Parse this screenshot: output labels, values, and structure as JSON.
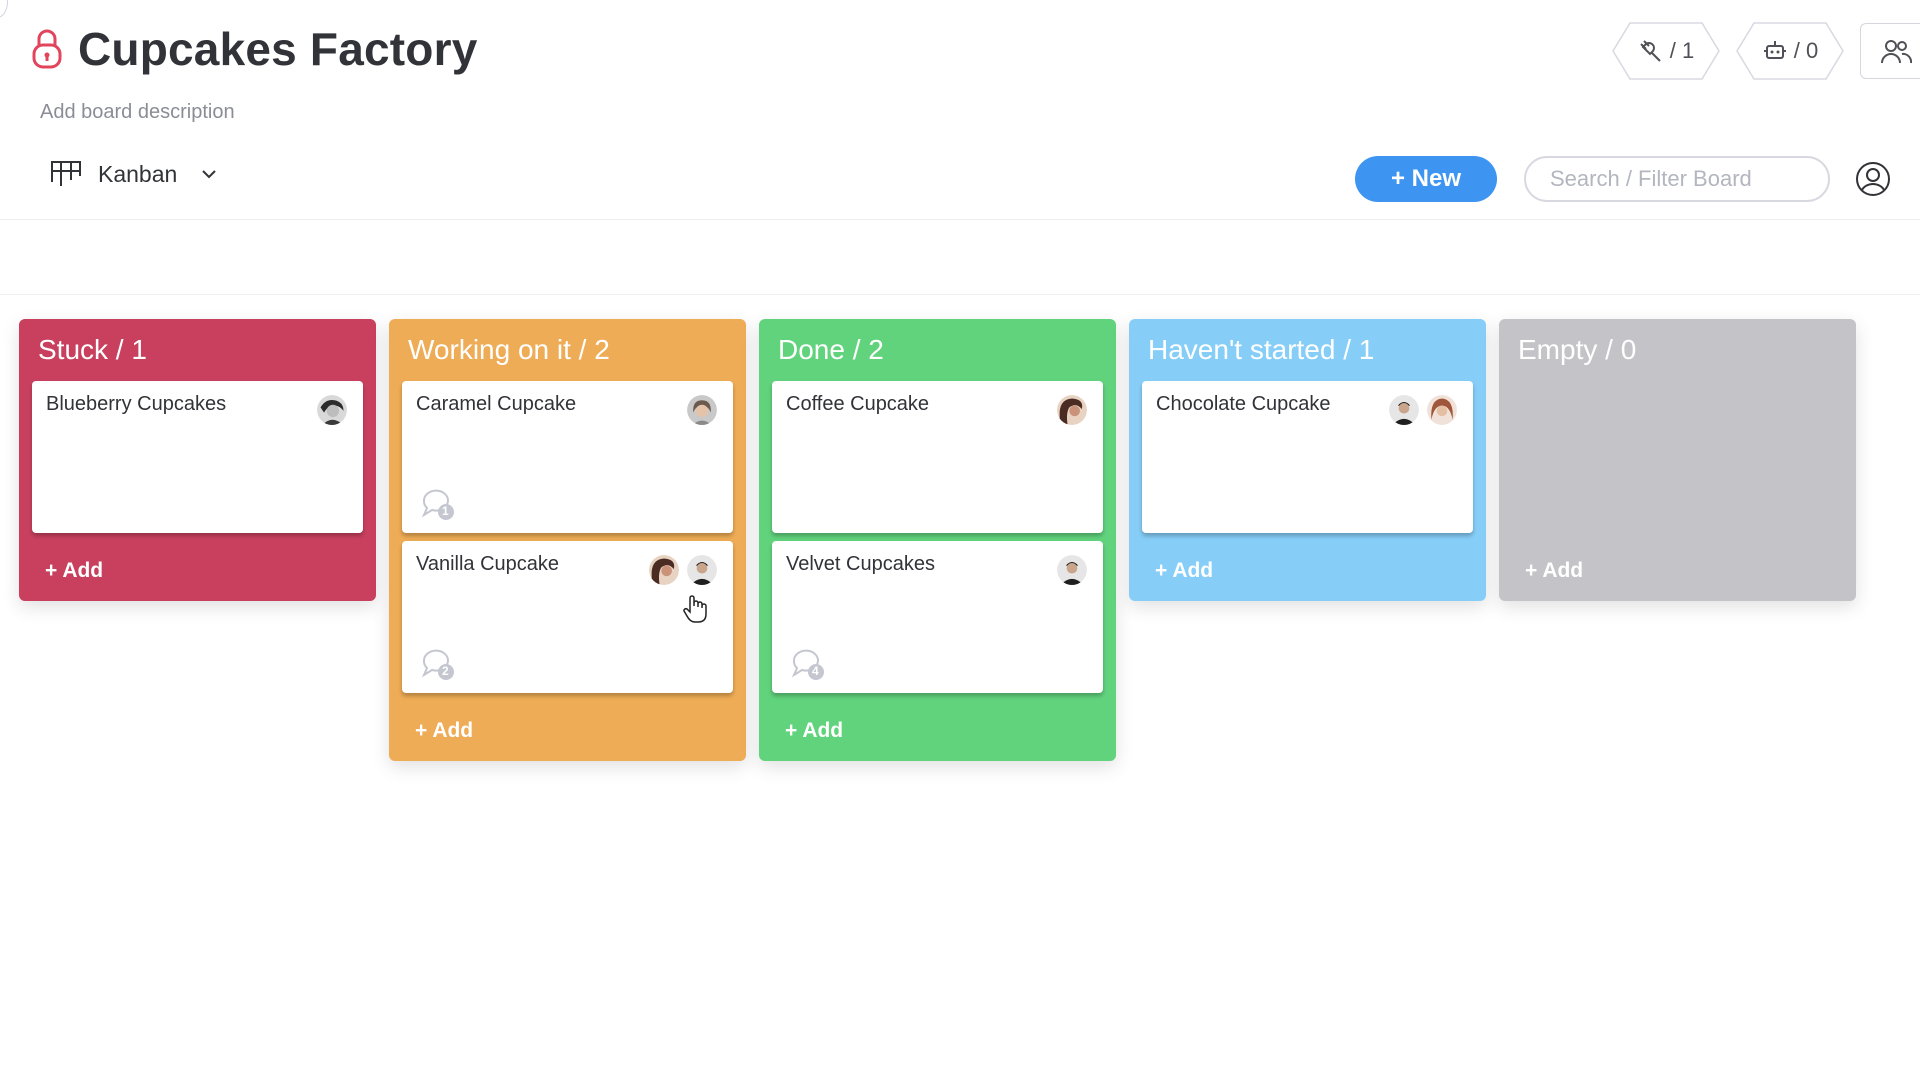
{
  "board": {
    "title": "Cupcakes Factory",
    "description": "Add board description",
    "lock_color": "#e2445c"
  },
  "header_actions": {
    "integrations_count": "/ 1",
    "automations_count": "/ 0",
    "integrations_icon": "plug-icon",
    "automations_icon": "robot-icon",
    "members_icon": "people-icon"
  },
  "toolbar": {
    "view_label": "Kanban",
    "new_label": "+ New",
    "search_placeholder": "Search / Filter Board",
    "accent": "#3d95f1"
  },
  "columns": [
    {
      "title": "Stuck / 1",
      "color": "#c9405f",
      "cards": [
        {
          "name": "Blueberry Cupcakes",
          "avatars": [
            "avatar-woman-bw"
          ],
          "comments": null
        }
      ],
      "add_label": "+ Add"
    },
    {
      "title": "Working on it / 2",
      "color": "#eeac56",
      "cards": [
        {
          "name": "Caramel Cupcake",
          "avatars": [
            "avatar-woman-gray"
          ],
          "comments": "1"
        },
        {
          "name": "Vanilla Cupcake",
          "avatars": [
            "avatar-woman-dark-hair",
            "avatar-man-dark"
          ],
          "comments": "2"
        }
      ],
      "add_label": "+ Add"
    },
    {
      "title": "Done / 2",
      "color": "#61d37d",
      "cards": [
        {
          "name": "Coffee Cupcake",
          "avatars": [
            "avatar-woman-dark-hair"
          ],
          "comments": null
        },
        {
          "name": "Velvet Cupcakes",
          "avatars": [
            "avatar-man-dark"
          ],
          "comments": "4"
        }
      ],
      "add_label": "+ Add"
    },
    {
      "title": "Haven't started / 1",
      "color": "#86cef8",
      "cards": [
        {
          "name": "Chocolate Cupcake",
          "avatars": [
            "avatar-man-dark",
            "avatar-woman-red-hair"
          ],
          "comments": null
        }
      ],
      "add_label": "+ Add"
    },
    {
      "title": "Empty / 0",
      "color": "#c4c4c8",
      "cards": [],
      "add_label": "+ Add"
    }
  ]
}
